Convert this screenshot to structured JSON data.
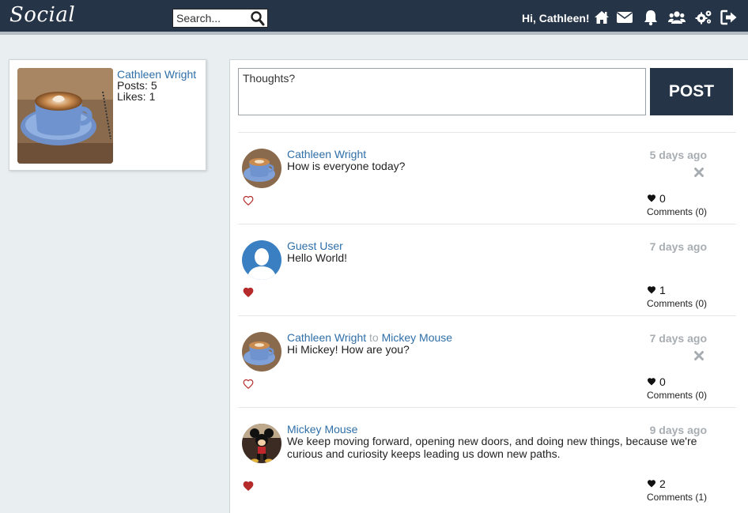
{
  "app": {
    "logo": "Social"
  },
  "header": {
    "search_placeholder": "Search...",
    "greeting": "Hi, Cathleen!",
    "icons": [
      "home-icon",
      "envelope-icon",
      "bell-icon",
      "users-icon",
      "gears-icon",
      "sign-out-icon"
    ]
  },
  "profile": {
    "name": "Cathleen Wright",
    "posts_label": "Posts:",
    "posts": "5",
    "likes_label": "Likes:",
    "likes": "1"
  },
  "composer": {
    "placeholder": "Thoughts?",
    "button": "POST"
  },
  "posts": [
    {
      "author": "Cathleen Wright",
      "to_word": "",
      "recipient": "",
      "message": "How is everyone today?",
      "time": "5 days ago",
      "liked": false,
      "likes": "0",
      "comments": "Comments (0)",
      "deletable": true,
      "avatar": "coffee"
    },
    {
      "author": "Guest User",
      "to_word": "",
      "recipient": "",
      "message": "Hello World!",
      "time": "7 days ago",
      "liked": true,
      "likes": "1",
      "comments": "Comments (0)",
      "deletable": false,
      "avatar": "guest"
    },
    {
      "author": "Cathleen Wright",
      "to_word": "to",
      "recipient": "Mickey Mouse",
      "message": "Hi Mickey! How are you?",
      "time": "7 days ago",
      "liked": false,
      "likes": "0",
      "comments": "Comments (0)",
      "deletable": true,
      "avatar": "coffee"
    },
    {
      "author": "Mickey Mouse",
      "to_word": "",
      "recipient": "",
      "message": "We keep moving forward, opening new doors, and doing new things, because we're curious and curiosity keeps leading us down new paths.",
      "time": "9 days ago",
      "liked": true,
      "likes": "2",
      "comments": "Comments (1)",
      "deletable": false,
      "avatar": "mickey"
    }
  ],
  "colors": {
    "nav": "#253446",
    "link": "#2f6fa8",
    "like": "#b52a2a",
    "muted": "#a8adb2"
  }
}
